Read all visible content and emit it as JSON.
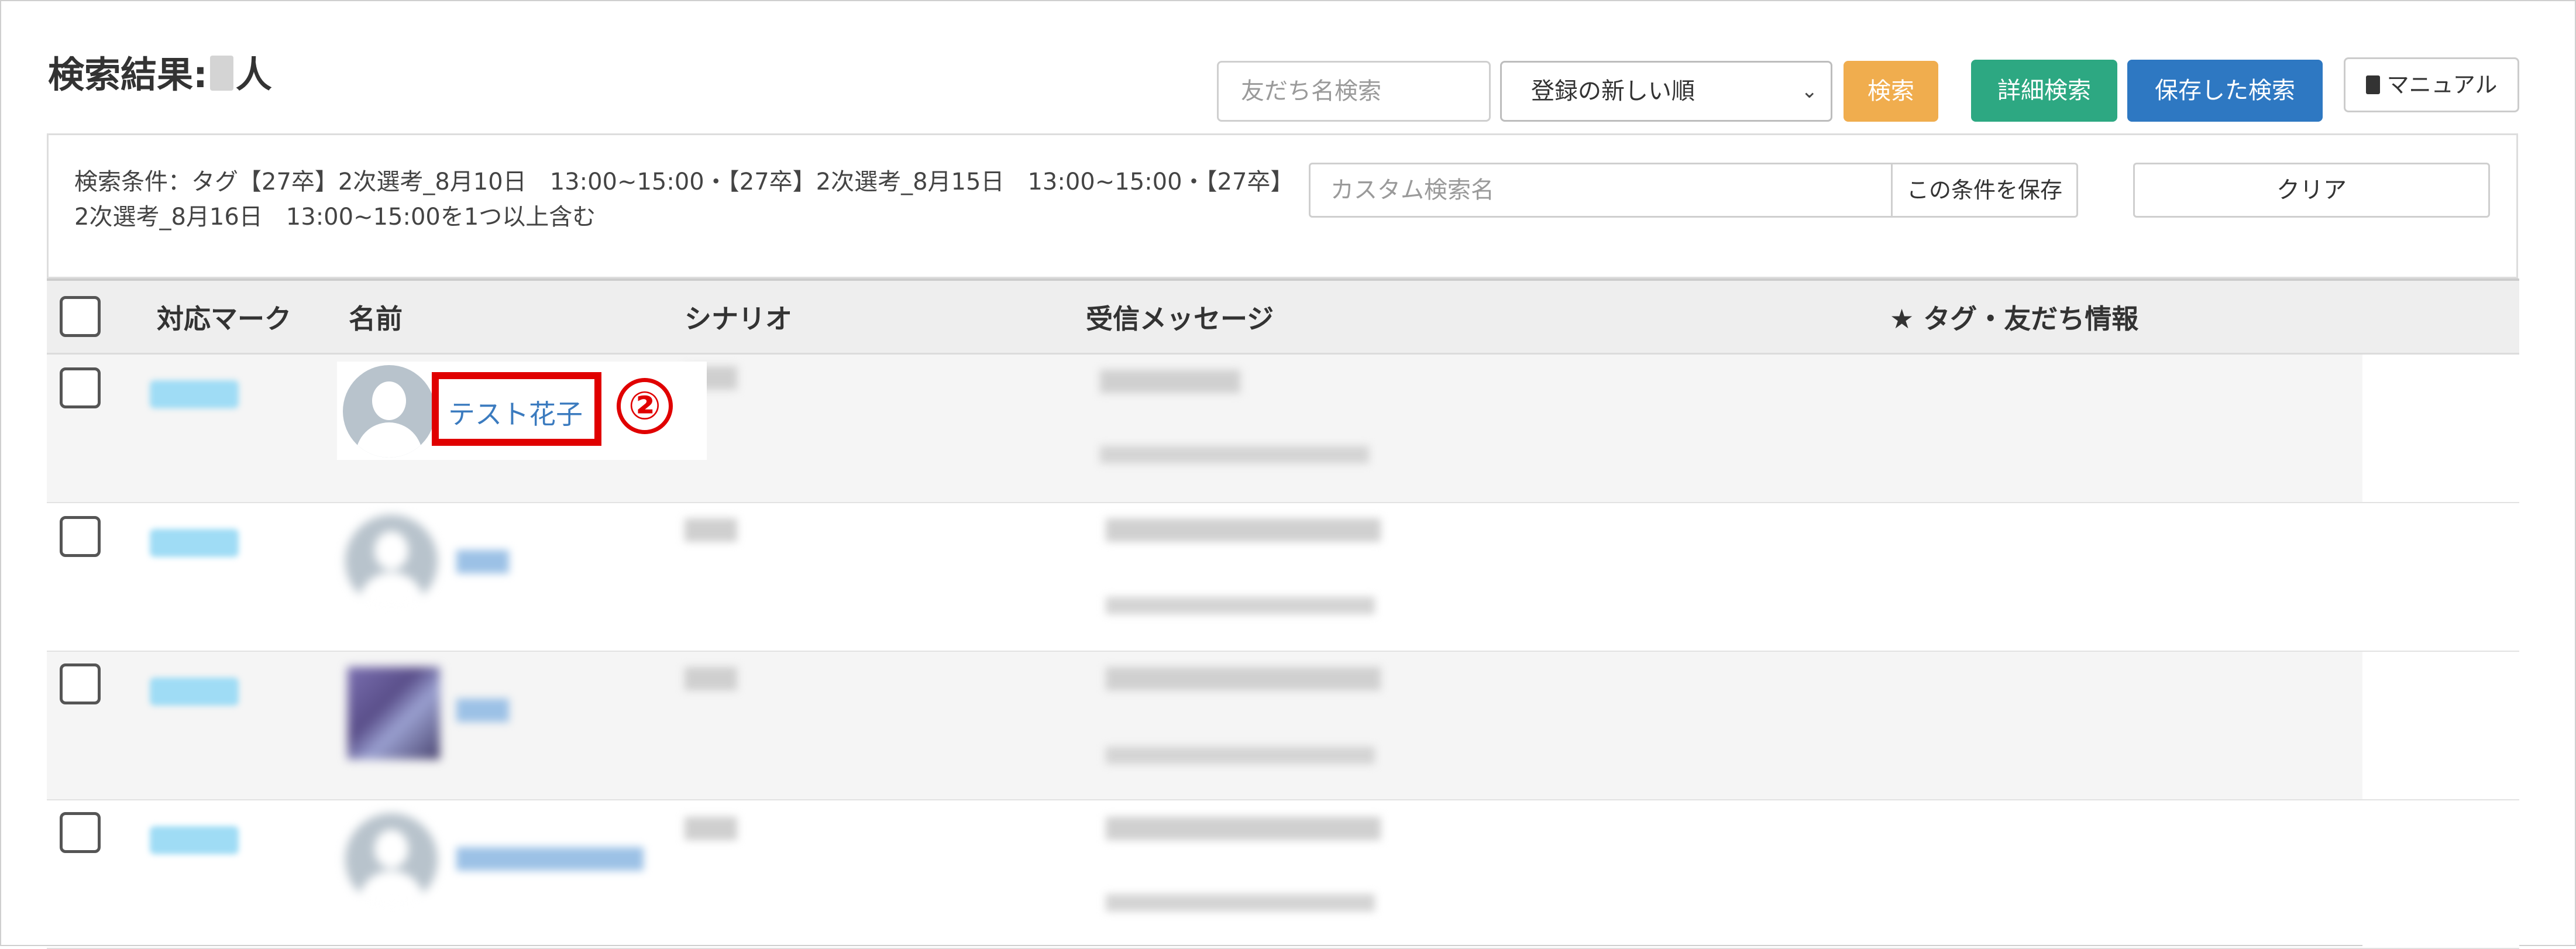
{
  "header": {
    "title_prefix": "検索結果:",
    "title_suffix": "人",
    "search_placeholder": "友だち名検索",
    "sort_selected": "登録の新しい順",
    "search_button": "検索",
    "advanced_search_button": "詳細検索",
    "saved_search_button": "保存した検索",
    "manual_button": "マニュアル"
  },
  "conditions": {
    "text": "検索条件：タグ【27卒】2次選考_8月10日　13:00~15:00・【27卒】2次選考_8月15日　13:00~15:00・【27卒】2次選考_8月16日　13:00~15:00を1つ以上含む",
    "custom_name_placeholder": "カスタム検索名",
    "save_condition_button": "この条件を保存",
    "clear_button": "クリア"
  },
  "table": {
    "columns": [
      "対応マーク",
      "名前",
      "シナリオ",
      "受信メッセージ",
      "★ タグ・友だち情報"
    ],
    "rows": [
      {
        "name": "テスト花子"
      }
    ]
  },
  "annotation": {
    "step_number": "②",
    "color": "#e00000"
  },
  "colors": {
    "search_button": "#f0ad4e",
    "advanced_search_button": "#2da882",
    "saved_search_button": "#2e78c2",
    "link": "#3b7bbf"
  }
}
